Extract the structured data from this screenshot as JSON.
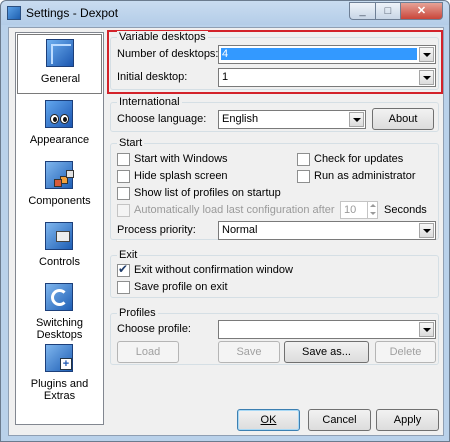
{
  "window": {
    "title": "Settings - Dexpot"
  },
  "sidebar": {
    "items": [
      {
        "label": "General",
        "icon": "general-icon",
        "selected": true
      },
      {
        "label": "Appearance",
        "icon": "appearance-icon"
      },
      {
        "label": "Components",
        "icon": "components-icon"
      },
      {
        "label": "Controls",
        "icon": "controls-icon"
      },
      {
        "label": "Switching Desktops",
        "icon": "switching-desktops-icon"
      },
      {
        "label": "Plugins and Extras",
        "icon": "plugins-icon"
      }
    ]
  },
  "variable_desktops": {
    "title": "Variable desktops",
    "number_label": "Number of desktops:",
    "number_value": "4",
    "initial_label": "Initial desktop:",
    "initial_value": "1"
  },
  "international": {
    "title": "International",
    "language_label": "Choose language:",
    "language_value": "English",
    "about_label": "About"
  },
  "start": {
    "title": "Start",
    "start_with_windows": "Start with Windows",
    "check_updates": "Check for updates",
    "hide_splash": "Hide splash screen",
    "run_admin": "Run as administrator",
    "show_profiles": "Show list of profiles on startup",
    "auto_load": "Automatically load last configuration after",
    "seconds_value": "10",
    "seconds_label": "Seconds",
    "priority_label": "Process priority:",
    "priority_value": "Normal"
  },
  "exit": {
    "title": "Exit",
    "exit_without_confirm": "Exit without confirmation window",
    "exit_without_confirm_checked": true,
    "save_profile": "Save profile on exit"
  },
  "profiles": {
    "title": "Profiles",
    "choose_label": "Choose profile:",
    "choose_value": "",
    "load": "Load",
    "save": "Save",
    "save_as": "Save as...",
    "delete": "Delete"
  },
  "footer": {
    "ok": "OK",
    "cancel": "Cancel",
    "apply": "Apply"
  },
  "colors": {
    "highlight_border": "#d3222a",
    "selection": "#3399ff"
  }
}
